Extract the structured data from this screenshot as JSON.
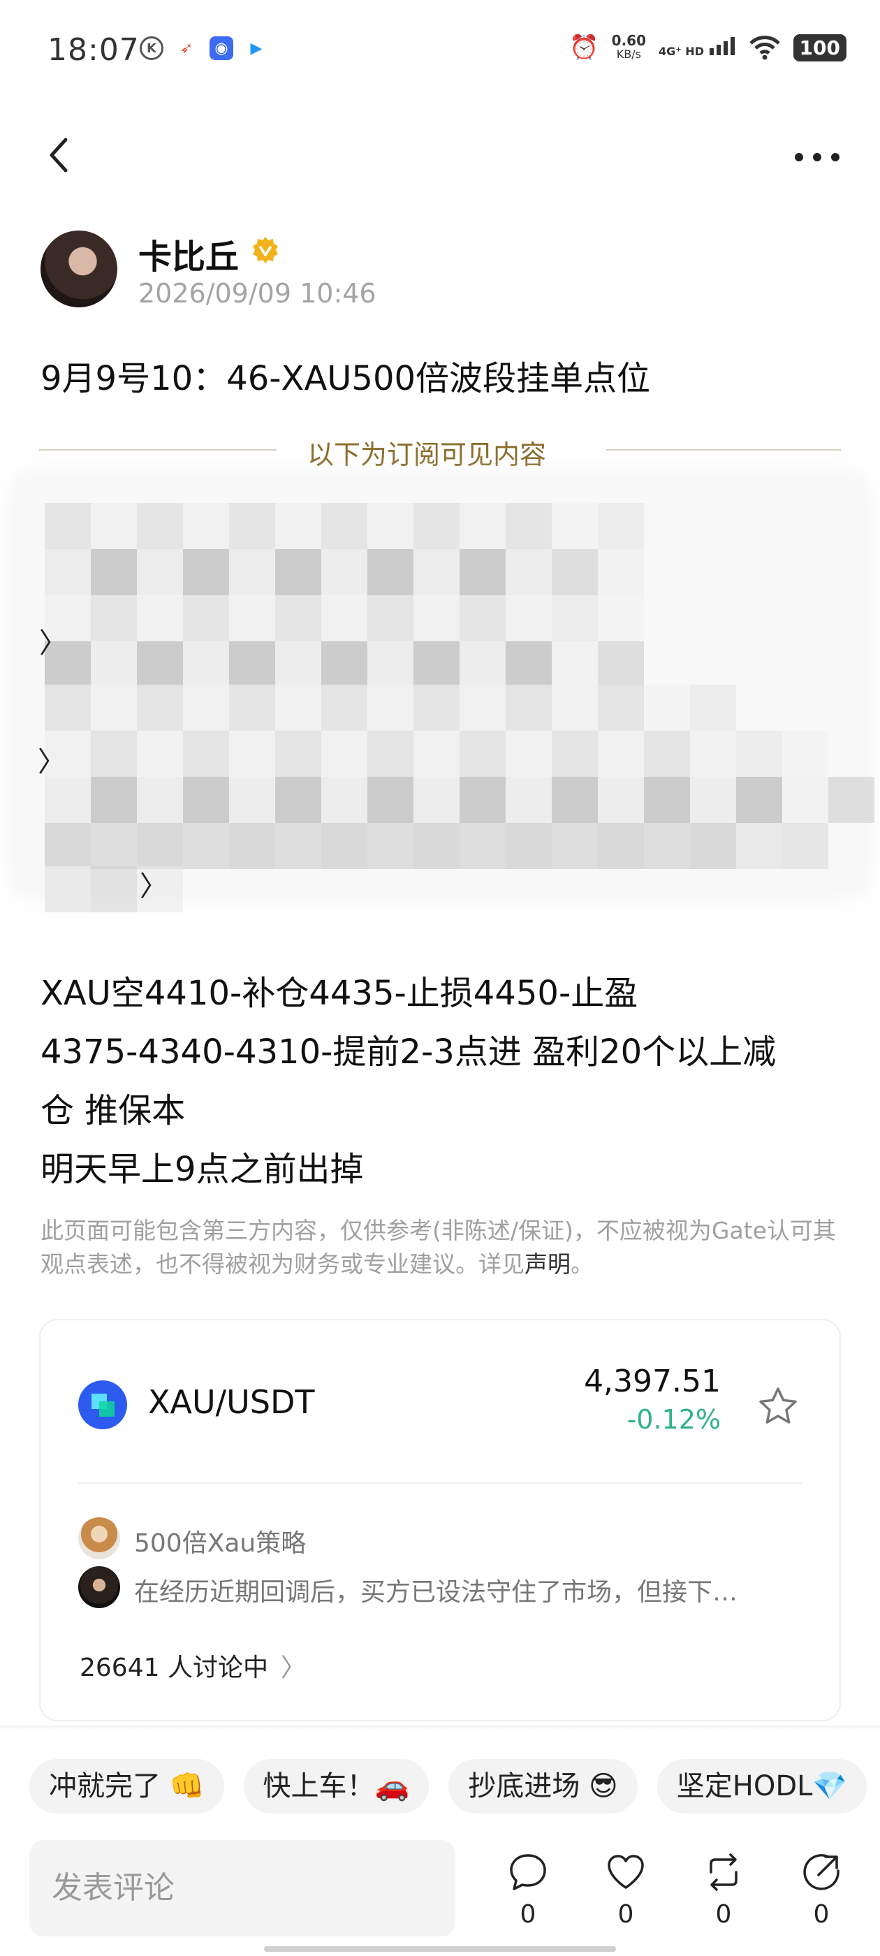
{
  "status_bar": {
    "time": "18:07",
    "speed_value": "0.60",
    "speed_unit": "KB/s",
    "network": "4G⁺ HD",
    "battery": "100"
  },
  "author": {
    "name": "卡比丘",
    "timestamp": "2026/09/09 10:46",
    "verified_color": "#f2b21c"
  },
  "post": {
    "title": "9月9号10：46-XAU500倍波段挂单点位",
    "subscription_label": "以下为订阅可见内容",
    "body_lines": [
      "XAU空4410-补仓4435-止损4450-止盈",
      "4375-4340-4310-提前2-3点进 盈利20个以上减",
      "仓 推保本",
      "明天早上9点之前出掉"
    ]
  },
  "disclaimer": {
    "text": "此页面可能包含第三方内容，仅供参考(非陈述/保证)，不应被视为Gate认可其观点表述，也不得被视为财务或专业建议。详见",
    "link": "声明",
    "end": "。"
  },
  "market_card": {
    "pair": "XAU/USDT",
    "price": "4,397.51",
    "change": "-0.12%",
    "change_color": "#2eb388",
    "topic_name": "500倍Xau策略",
    "topic_comment": "在经历近期回调后，买方已设法守住了市场，但接下…",
    "discussing": "26641 人讨论中"
  },
  "reactions": {
    "chips": [
      "冲就完了 👊",
      "快上车！🚗",
      "抄底进场 😎",
      "坚定HODL💎"
    ]
  },
  "bottom_bar": {
    "comment_placeholder": "发表评论",
    "comment_count": "0",
    "like_count": "0",
    "repost_count": "0",
    "share_count": "0"
  }
}
